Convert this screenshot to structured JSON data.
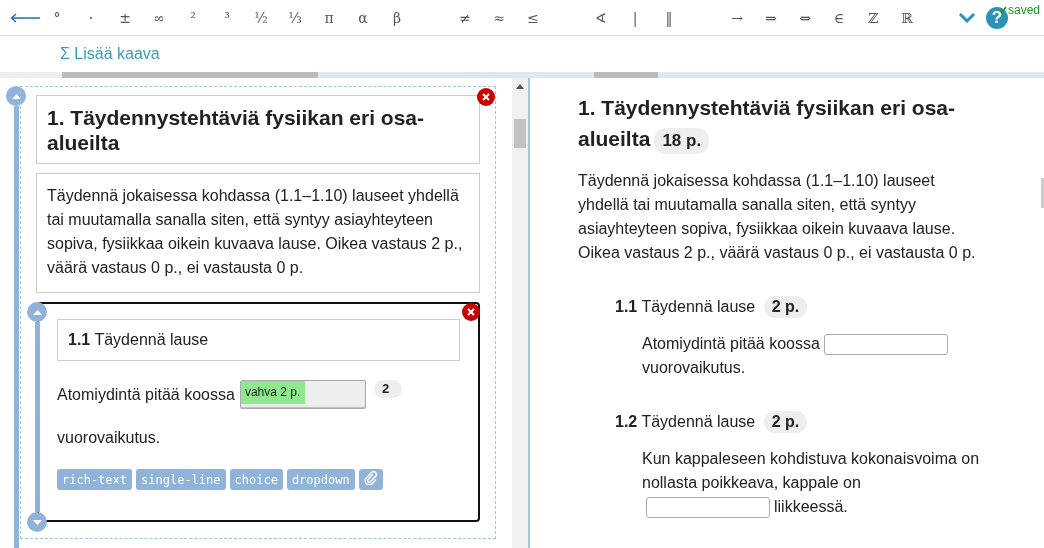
{
  "toolbar": {
    "symbol_groups": [
      [
        "°",
        "·",
        "±",
        "∞",
        "²",
        "³",
        "½",
        "⅓",
        "π",
        "α",
        "β"
      ],
      [
        "≠",
        "≈",
        "≤"
      ],
      [
        "∢",
        "|",
        "‖"
      ],
      [
        "→",
        "⇒",
        "⇔",
        "∈",
        "ℤ",
        "ℝ"
      ]
    ],
    "help": "?",
    "status": "saved"
  },
  "formula_button": "Σ Lisää kaava",
  "editor": {
    "title": "1. Täydennystehtäviä fysiikan eri osa-alueilta",
    "description": "Täydennä jokaisessa kohdassa (1.1–1.10) lauseet yhdellä tai muutamalla sanalla siten, että syntyy asiayhteyteen sopiva, fysiikkaa oikein kuvaava lause. Oikea vastaus 2 p., väärä vastaus 0 p., ei vastausta 0 p.",
    "questions": [
      {
        "title": "**1.1** Täydennä lause",
        "text_before": "Atomiydintä pitää koossa",
        "answers": [
          "vahva 2 p."
        ],
        "score": "2",
        "text_after": "vuorovaikutus.",
        "tags": [
          "rich-text",
          "single-line",
          "choice",
          "dropdown"
        ]
      }
    ]
  },
  "preview": {
    "title": "1. Täydennystehtäviä fysiikan eri osa-alueilta",
    "points": "18 p.",
    "description": "Täydennä jokaisessa kohdassa (1.1–1.10) lauseet yhdellä tai muutamalla sanalla siten, että syntyy asiayhteyteen sopiva, fysiikkaa oikein kuvaava lause. Oikea vastaus 2 p., väärä vastaus 0 p., ei vastausta 0 p.",
    "questions": [
      {
        "number": "1.1",
        "title": "Täydennä lause",
        "points": "2 p.",
        "parts": [
          {
            "kind": "text",
            "text": "Atomiydintä pitää koossa"
          },
          {
            "kind": "field"
          },
          {
            "kind": "text",
            "text": "vuorovaikutus."
          }
        ]
      },
      {
        "number": "1.2",
        "title": "Täydennä lause",
        "points": "2 p.",
        "parts": [
          {
            "kind": "text",
            "text": "Kun kappaleseen kohdistuva kokonaisvoima on nollasta poikkeava, kappale on"
          },
          {
            "kind": "field"
          },
          {
            "kind": "text",
            "text": "liikkeessä."
          }
        ]
      }
    ]
  }
}
